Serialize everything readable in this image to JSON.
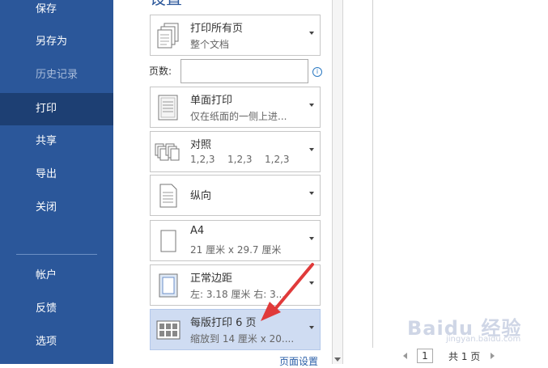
{
  "sidebar": {
    "items": [
      {
        "label": "保存"
      },
      {
        "label": "另存为"
      },
      {
        "label": "历史记录"
      },
      {
        "label": "打印"
      },
      {
        "label": "共享"
      },
      {
        "label": "导出"
      },
      {
        "label": "关闭"
      },
      {
        "label": "帐户"
      },
      {
        "label": "反馈"
      },
      {
        "label": "选项"
      }
    ],
    "active": "打印"
  },
  "settings": {
    "title": "设置",
    "scope": {
      "title": "打印所有页",
      "subtitle": "整个文档"
    },
    "pages": {
      "label": "页数:",
      "value": "",
      "info_icon": "i"
    },
    "sides": {
      "title": "单面打印",
      "subtitle": "仅在纸面的一侧上进..."
    },
    "collate": {
      "title": "对照",
      "subtitle": [
        "1,2,3",
        "1,2,3",
        "1,2,3"
      ]
    },
    "orientation": {
      "title": "纵向"
    },
    "paper": {
      "title": "A4",
      "subtitle": "21 厘米 x 29.7 厘米"
    },
    "margins": {
      "title": "正常边距",
      "subtitle": "左: 3.18 厘米    右: 3..."
    },
    "per_sheet": {
      "title": "每版打印 6 页",
      "subtitle": "缩放到 14 厘米 x 20...."
    },
    "page_setup_link": "页面设置"
  },
  "pager": {
    "current": "1",
    "total_text": "共 1 页"
  },
  "watermark": {
    "text": "Baidu 经验",
    "sub": "jingyan.baidu.com"
  },
  "colors": {
    "sidebar": "#2b579a",
    "sidebar_active": "#1d3f73",
    "selected_option": "#cfdcf2",
    "arrow": "#e03a3a"
  }
}
